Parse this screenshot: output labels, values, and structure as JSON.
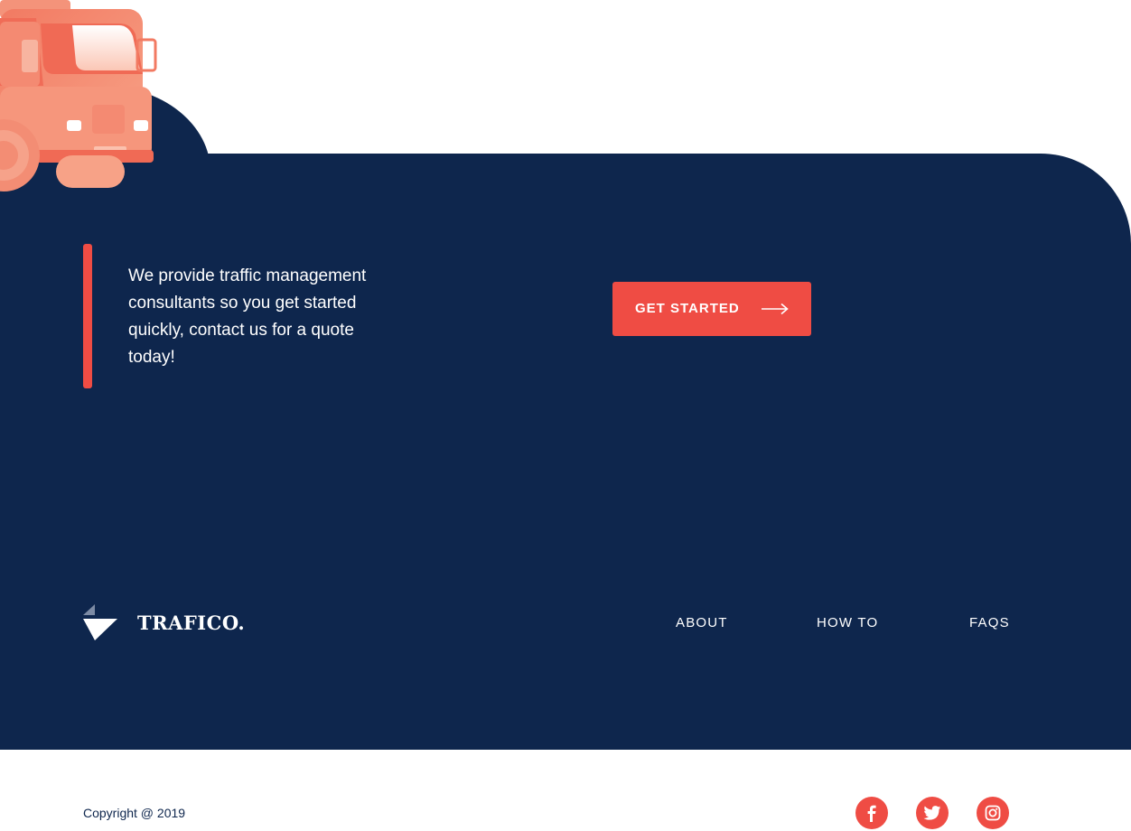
{
  "cta": {
    "text": "We provide traffic management consultants so you get started quickly, contact us for a quote today!",
    "button_label": "GET STARTED",
    "arrow_icon": "long-arrow-right-icon"
  },
  "brand": {
    "name": "TRAFICO.",
    "logo_icon": "trafico-logo-mark"
  },
  "footer_nav": {
    "items": [
      {
        "label": "ABOUT"
      },
      {
        "label": "HOW TO"
      },
      {
        "label": "FAQS"
      }
    ]
  },
  "copyright": "Copyright @ 2019",
  "social": [
    {
      "icon": "facebook-icon"
    },
    {
      "icon": "twitter-icon"
    },
    {
      "icon": "instagram-icon"
    }
  ],
  "colors": {
    "navy": "#0e264d",
    "accent": "#ef4c44",
    "truck": "#f58a6f",
    "white": "#ffffff"
  }
}
